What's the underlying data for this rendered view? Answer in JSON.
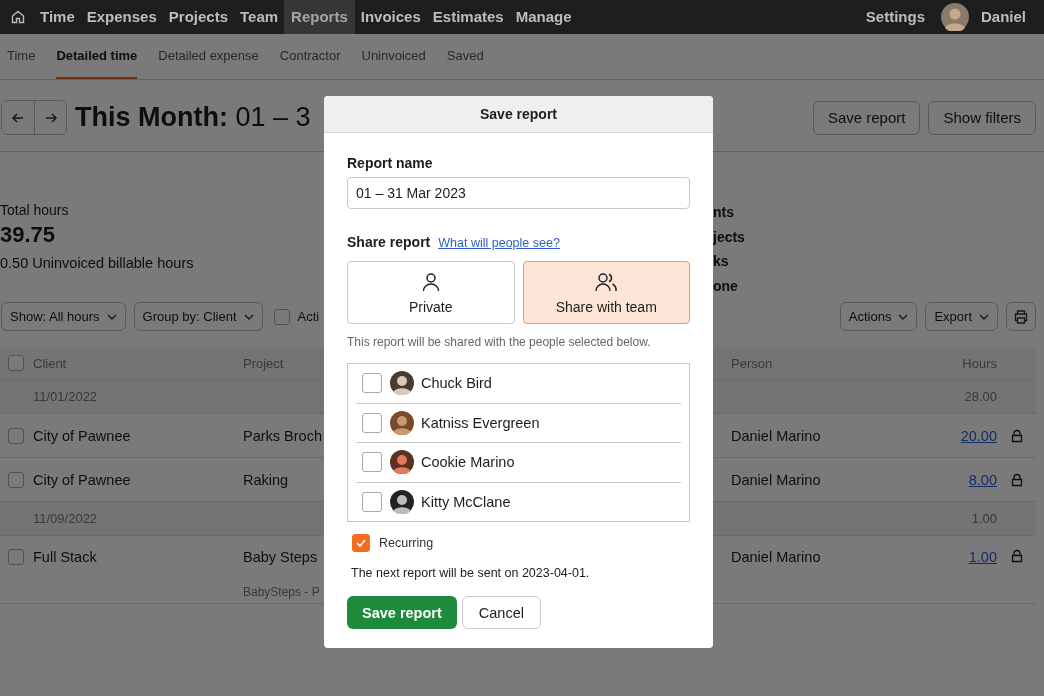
{
  "nav": {
    "items": [
      {
        "label": "Time",
        "selected": false
      },
      {
        "label": "Expenses",
        "selected": false
      },
      {
        "label": "Projects",
        "selected": false
      },
      {
        "label": "Team",
        "selected": false
      },
      {
        "label": "Reports",
        "selected": true
      },
      {
        "label": "Invoices",
        "selected": false
      },
      {
        "label": "Estimates",
        "selected": false
      },
      {
        "label": "Manage",
        "selected": false
      }
    ],
    "settings": "Settings",
    "user": "Daniel"
  },
  "subtabs": [
    {
      "label": "Time",
      "selected": false
    },
    {
      "label": "Detailed time",
      "selected": true
    },
    {
      "label": "Detailed expense",
      "selected": false
    },
    {
      "label": "Contractor",
      "selected": false
    },
    {
      "label": "Uninvoiced",
      "selected": false
    },
    {
      "label": "Saved",
      "selected": false
    }
  ],
  "header": {
    "title": "**This Month:** 01 – 3",
    "buttons": [
      "Save report",
      "Show filters"
    ]
  },
  "summary": {
    "label": "Total hours",
    "value": "39.75",
    "note": "0.50 Uninvoiced billable hours",
    "breakdown": [
      "nts",
      "jects",
      "ks",
      "one"
    ]
  },
  "toolbar": {
    "filters": [
      "Show: All hours",
      "Group by: Client"
    ],
    "toggle": {
      "label": "Acti",
      "checked": false
    },
    "menus": [
      "Actions",
      "Export"
    ]
  },
  "table": {
    "select_all": false,
    "columns": [
      "Client",
      "Project",
      "Person",
      "Hours"
    ],
    "rows": [
      {
        "kind": "group",
        "date": "11/01/2022",
        "hours": "28.00"
      },
      {
        "kind": "entry",
        "checked": false,
        "client": "City of Pawnee",
        "project": "Parks Broch",
        "person": "Daniel Marino",
        "hours": "20.00"
      },
      {
        "kind": "entry",
        "checked": false,
        "client": "City of Pawnee",
        "project": "Raking",
        "person": "Daniel Marino",
        "hours": "8.00"
      },
      {
        "kind": "group",
        "date": "11/09/2022",
        "hours": "1.00"
      },
      {
        "kind": "entry",
        "checked": false,
        "client": "Full Stack",
        "project": "Baby Steps",
        "note": "BabySteps - P",
        "person": "Daniel Marino",
        "hours": "1.00"
      }
    ]
  },
  "dialog": {
    "title": "Save report",
    "name_label": "Report name",
    "name_value": "01 – 31 Mar 2023",
    "share_label": "Share report",
    "share_link": "What will people see?",
    "share_options": [
      {
        "kind": "person",
        "label": "Private",
        "selected": false
      },
      {
        "kind": "team",
        "label": "Share with team",
        "selected": true
      }
    ],
    "share_note": "This report will be shared with the people selected below.",
    "people": [
      {
        "name": "Chuck Bird",
        "checked": false
      },
      {
        "name": "Katniss Evergreen",
        "checked": false
      },
      {
        "name": "Cookie Marino",
        "checked": false
      },
      {
        "name": "Kitty McClane",
        "checked": false
      }
    ],
    "recurring": {
      "label": "Recurring",
      "checked": true
    },
    "next_note": "The next report will be sent on 2023-04-01.",
    "save": "Save report",
    "cancel": "Cancel"
  }
}
